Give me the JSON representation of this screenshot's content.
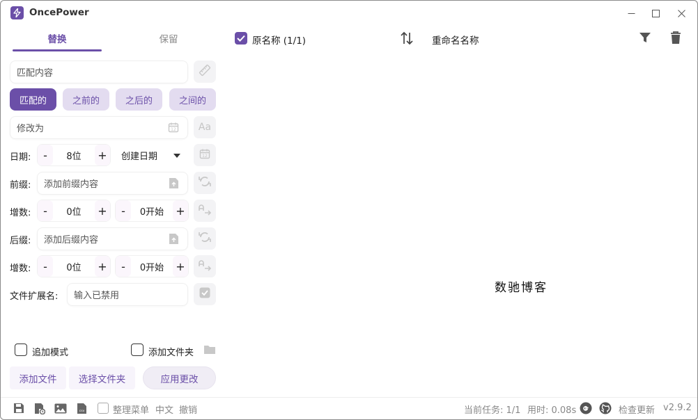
{
  "app": {
    "title": "OncePower",
    "accent": "#6b4fa8"
  },
  "tabs": [
    {
      "label": "替换"
    },
    {
      "label": "保留"
    }
  ],
  "match": {
    "placeholder": "匹配内容"
  },
  "modes": [
    {
      "label": "匹配的",
      "active": true
    },
    {
      "label": "之前的"
    },
    {
      "label": "之后的"
    },
    {
      "label": "之间的"
    }
  ],
  "replace": {
    "placeholder": "修改为"
  },
  "date": {
    "label": "日期:",
    "digits": "8位",
    "type": "创建日期"
  },
  "prefix": {
    "label": "前缀:",
    "placeholder": "添加前缀内容"
  },
  "prefix_increment": {
    "label": "增数:",
    "digits": "0位",
    "start": "0开始"
  },
  "suffix": {
    "label": "后缀:",
    "placeholder": "添加后缀内容"
  },
  "suffix_increment": {
    "label": "增数:",
    "digits": "0位",
    "start": "0开始"
  },
  "extension": {
    "label": "文件扩展名:",
    "placeholder": "输入已禁用"
  },
  "options": {
    "append_mode": "追加模式",
    "add_folder": "添加文件夹"
  },
  "actions": {
    "add_file": "添加文件",
    "select_folder": "选择文件夹",
    "apply": "应用更改"
  },
  "stepper": {
    "minus": "-",
    "plus": "+"
  },
  "list": {
    "original_header": "原名称 (1/1)",
    "renamed_header": "重命名名称",
    "watermark": "数驰博客"
  },
  "status": {
    "tidy_menu": "整理菜单",
    "language": "中文",
    "undo": "撤销",
    "task": "当前任务: 1/1",
    "time": "用时: 0.08s",
    "check_update": "检查更新",
    "version": "v2.9.2"
  }
}
